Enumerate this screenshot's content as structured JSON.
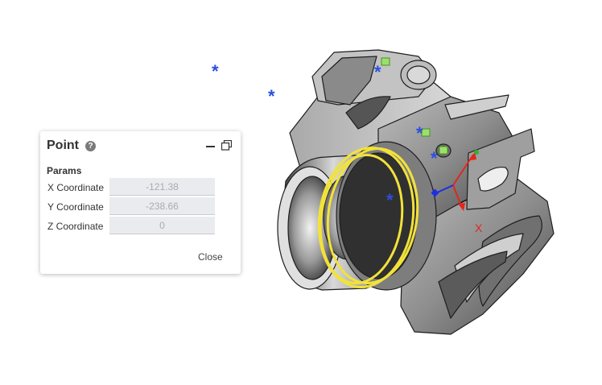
{
  "point_panel": {
    "title": "Point",
    "help_icon": "?",
    "section_label": "Params",
    "fields": [
      {
        "label": "X Coordinate",
        "value": "-121.38"
      },
      {
        "label": "Y Coordinate",
        "value": "-238.66"
      },
      {
        "label": "Z Coordinate",
        "value": "0"
      }
    ],
    "close_label": "Close"
  },
  "viewport": {
    "axis_label_x": "X",
    "point_marker_glyph": "*",
    "colors": {
      "point_marker": "#2b4fe0",
      "selection_highlight": "#f2e23a",
      "axis_x": "#e3261c",
      "axis_y": "#2db52d",
      "axis_z": "#1b2fe6",
      "model_body": "#9c9c9c"
    }
  }
}
